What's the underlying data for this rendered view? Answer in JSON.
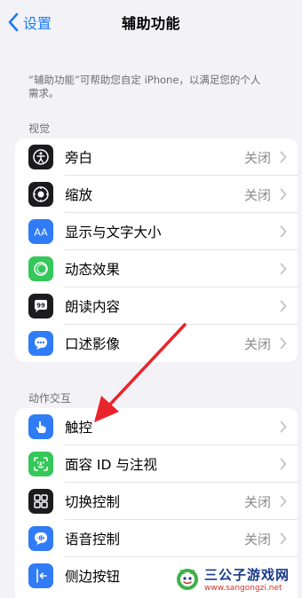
{
  "nav": {
    "back_label": "设置",
    "title": "辅助功能"
  },
  "description": "“辅助功能”可帮助您自定 iPhone，以满足您的个人需求。",
  "sections": [
    {
      "header": "视觉",
      "items": [
        {
          "label": "旁白",
          "value": "关闭",
          "icon": "voiceover-icon",
          "color": "#1c1c1e"
        },
        {
          "label": "缩放",
          "value": "关闭",
          "icon": "zoom-icon",
          "color": "#1c1c1e"
        },
        {
          "label": "显示与文字大小",
          "value": "",
          "icon": "display-text-size-icon",
          "color": "#2f7cf6"
        },
        {
          "label": "动态效果",
          "value": "",
          "icon": "motion-icon",
          "color": "#34c759"
        },
        {
          "label": "朗读内容",
          "value": "",
          "icon": "spoken-content-icon",
          "color": "#1c1c1e"
        },
        {
          "label": "口述影像",
          "value": "关闭",
          "icon": "audio-description-icon",
          "color": "#2f7cf6"
        }
      ]
    },
    {
      "header": "动作交互",
      "items": [
        {
          "label": "触控",
          "value": "",
          "icon": "touch-icon",
          "color": "#2f7cf6"
        },
        {
          "label": "面容 ID 与注视",
          "value": "",
          "icon": "face-id-icon",
          "color": "#34c759"
        },
        {
          "label": "切换控制",
          "value": "关闭",
          "icon": "switch-control-icon",
          "color": "#1c1c1e"
        },
        {
          "label": "语音控制",
          "value": "关闭",
          "icon": "voice-control-icon",
          "color": "#2f7cf6"
        },
        {
          "label": "侧边按钮",
          "value": "",
          "icon": "side-button-icon",
          "color": "#2f7cf6"
        }
      ]
    }
  ],
  "watermark": {
    "name": "三公子游戏网",
    "url": "www.sangongzi.net"
  },
  "colors": {
    "accent": "#1a7cf5",
    "annotation_arrow": "#e8252b"
  }
}
